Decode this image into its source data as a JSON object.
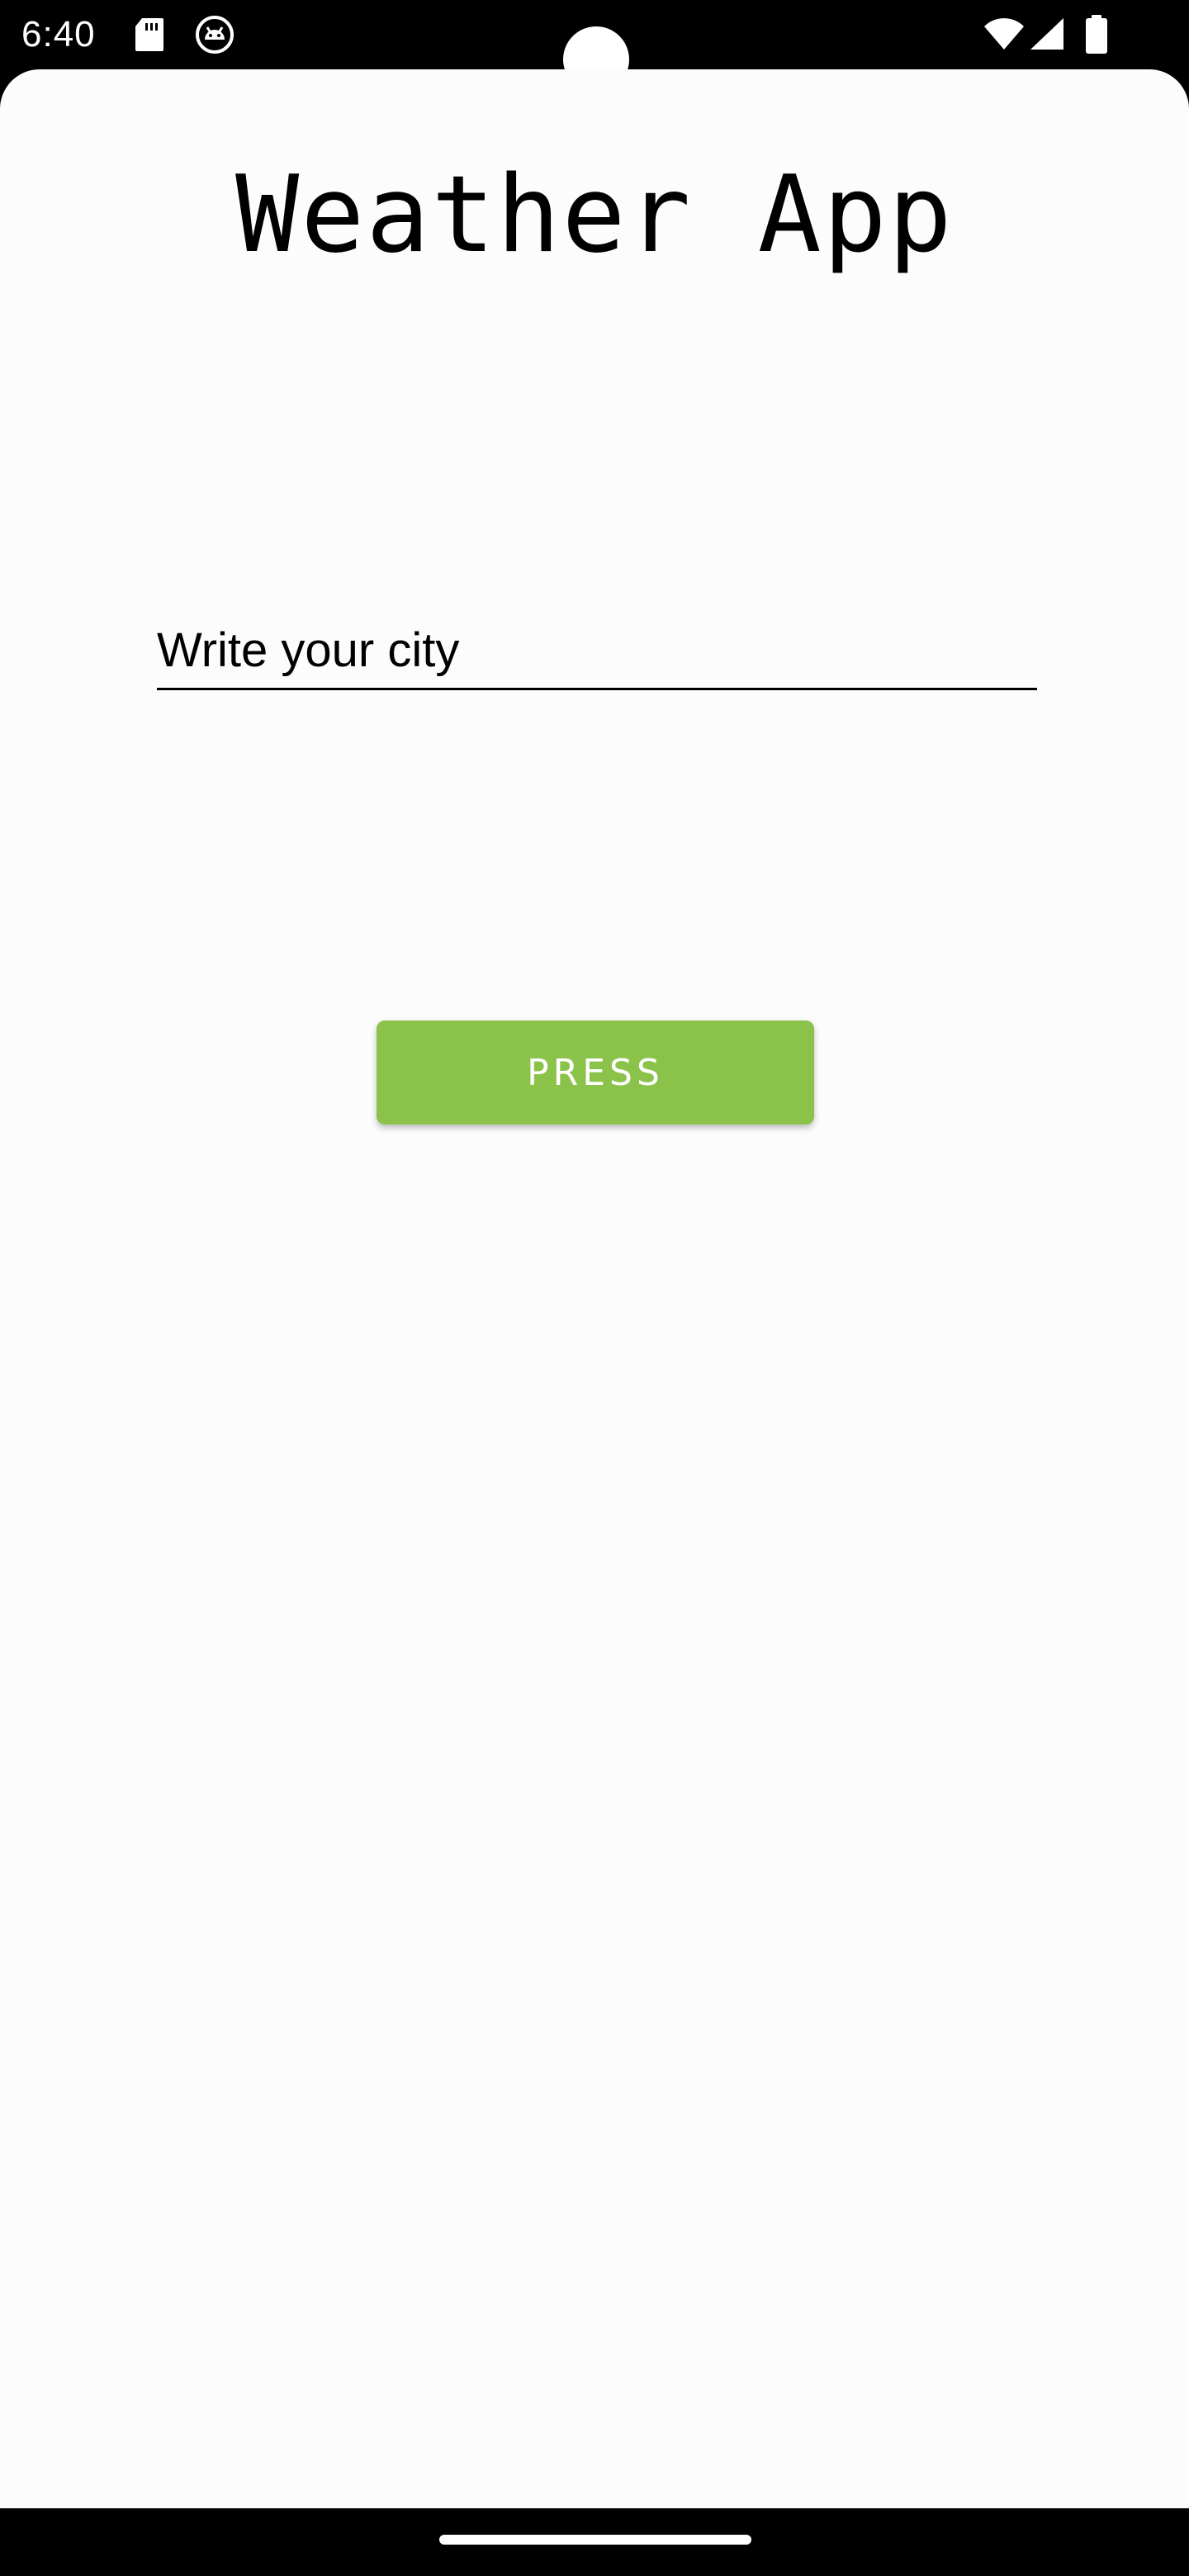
{
  "status_bar": {
    "time": "6:40",
    "icons": [
      "sd-card-icon",
      "android-debug-icon",
      "wifi-icon",
      "signal-icon",
      "battery-icon"
    ]
  },
  "app": {
    "title": "Weather App",
    "city_input": {
      "value": "",
      "placeholder": "Write your city"
    },
    "press_button_label": "PRESS",
    "accent_color": "#8bc34a"
  },
  "nav_bar": {
    "handle": "home-handle"
  }
}
